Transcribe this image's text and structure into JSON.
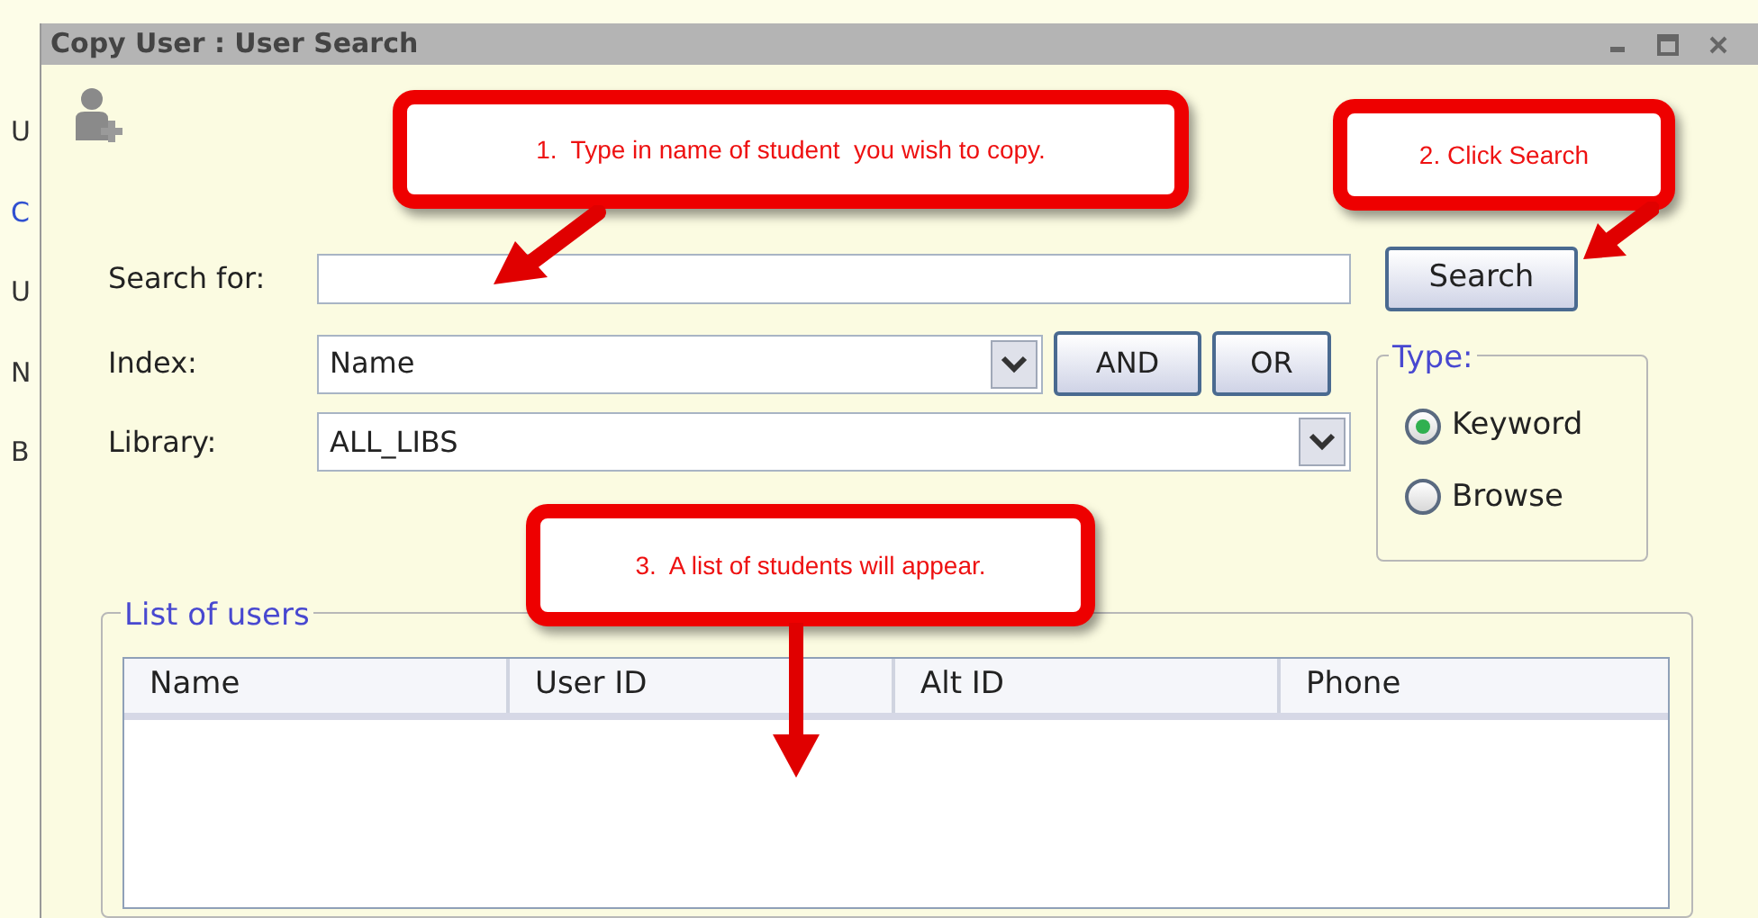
{
  "background_app": {
    "fragments": [
      "U",
      "C",
      "U",
      "N",
      "B"
    ]
  },
  "window": {
    "title": "Copy User : User Search"
  },
  "search": {
    "label": "Search for:",
    "button": "Search"
  },
  "index": {
    "label": "Index:",
    "value": "Name",
    "buttons": [
      "AND",
      "OR"
    ]
  },
  "library": {
    "label": "Library:",
    "value": "ALL_LIBS"
  },
  "type": {
    "legend": "Type:",
    "options": [
      {
        "label": "Keyword",
        "selected": true
      },
      {
        "label": "Browse",
        "selected": false
      }
    ]
  },
  "list_of_users": {
    "legend": "List of users",
    "columns": [
      "Name",
      "User ID",
      "Alt ID",
      "Phone"
    ]
  },
  "callouts": [
    {
      "text": "1.  Type in name of student  you wish to copy."
    },
    {
      "text": "2. Click Search"
    },
    {
      "text": "3.  A list of students will appear."
    }
  ]
}
